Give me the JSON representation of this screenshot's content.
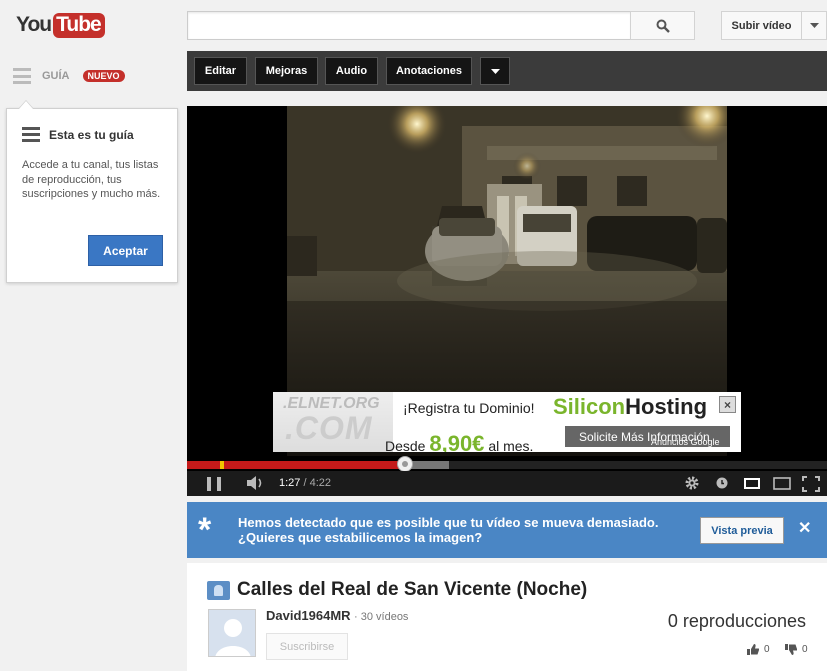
{
  "header": {
    "logo_you": "You",
    "logo_tube": "Tube",
    "search_placeholder": "",
    "upload_label": "Subir vídeo"
  },
  "guide": {
    "label": "GUÍA",
    "badge": "NUEVO",
    "popup_title": "Esta es tu guía",
    "popup_body": "Accede a tu canal, tus listas de reproducción, tus suscripciones y mucho más.",
    "accept_label": "Aceptar"
  },
  "toolbar": {
    "edit": "Editar",
    "enhancements": "Mejoras",
    "audio": "Audio",
    "annotations": "Anotaciones"
  },
  "ad": {
    "dom_text": ".ELNET.ORG",
    "com_text": ".COM",
    "registra": "¡Registra tu Dominio!",
    "brand_a": "Silicon",
    "brand_b": "Hosting",
    "desde": "Desde",
    "price": "8,90€",
    "per": "al mes.",
    "cta": "Solicite Más Información",
    "google": "Anuncios Google"
  },
  "player": {
    "current_time": "1:27",
    "duration": "4:22",
    "played_fraction": 0.34,
    "loaded_fraction": 0.41,
    "colors": {
      "played": "#c41a1a",
      "ad_marker": "#f0c400"
    }
  },
  "notice": {
    "line1": "Hemos detectado que es posible que tu vídeo se mueva demasiado.",
    "line2": "¿Quieres que estabilicemos la imagen?",
    "preview_label": "Vista previa"
  },
  "video": {
    "title": "Calles del Real de San Vicente (Noche)",
    "channel": "David1964MR",
    "video_count": "30 vídeos",
    "subscribe_label": "Suscribirse",
    "views": "0 reproducciones",
    "likes": "0",
    "dislikes": "0"
  }
}
